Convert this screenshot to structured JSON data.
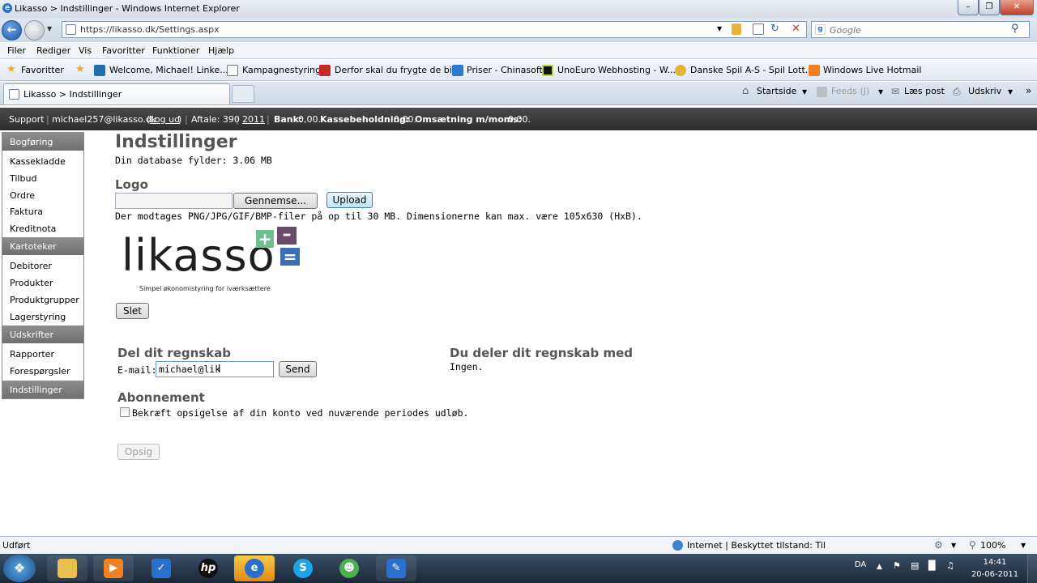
{
  "window": {
    "title": "Likasso > Indstillinger - Windows Internet Explorer"
  },
  "address": {
    "url": "https://likasso.dk/Settings.aspx",
    "search_placeholder": "Google"
  },
  "menu": [
    "Filer",
    "Rediger",
    "Vis",
    "Favoritter",
    "Funktioner",
    "Hjælp"
  ],
  "favorites_bar": {
    "favorites_label": "Favoritter",
    "items": [
      "Welcome, Michael! Linke...",
      "Kampagnestyring",
      "Derfor skal du frygte de bi...",
      "Priser - Chinasoft",
      "UnoEuro Webhosting - W...",
      "Danske Spil A-S - Spil Lott...",
      "Windows Live Hotmail"
    ]
  },
  "tab": {
    "label": "Likasso > Indstillinger"
  },
  "commandbar": {
    "home": "Startside",
    "feeds": "Feeds (J)",
    "read_mail": "Læs post",
    "print": "Udskriv"
  },
  "topbar": {
    "support": "Support",
    "email": "michael257@likasso.dk",
    "logout": "Log ud",
    "agreement": "Aftale: 390",
    "year": "2011",
    "bank_label": "Bank:",
    "bank_value": "0,00.",
    "cash_label": "Kassebeholdning:",
    "cash_value": "0,00.",
    "turnover_label": "Omsætning m/moms:",
    "turnover_value": "0,00."
  },
  "sidebar": {
    "sections": [
      {
        "title": "Bogføring",
        "items": [
          "Kassekladde",
          "Tilbud",
          "Ordre",
          "Faktura",
          "Kreditnota"
        ]
      },
      {
        "title": "Kartoteker",
        "items": [
          "Debitorer",
          "Produkter",
          "Produktgrupper",
          "Lagerstyring"
        ]
      },
      {
        "title": "Udskrifter",
        "items": [
          "Rapporter",
          "Forespørgsler"
        ]
      },
      {
        "title": "Indstillinger",
        "items": []
      }
    ]
  },
  "main": {
    "title": "Indstillinger",
    "db_size": "Din database fylder: 3.06 MB",
    "logo_heading": "Logo",
    "browse_button": "Gennemse...",
    "upload_button": "Upload",
    "logo_hint": "Der modtages PNG/JPG/GIF/BMP-filer på op til 30 MB. Dimensionerne kan max. være 105x630 (HxB).",
    "logo_text": "likasso",
    "logo_tagline": "Simpel økonomistyring for iværksættere",
    "delete_button": "Slet",
    "share_heading": "Del dit regnskab",
    "email_label": "E-mail:",
    "email_value": "michael@lik",
    "send_button": "Send",
    "shared_with_heading": "Du deler dit regnskab med",
    "shared_with_value": "Ingen.",
    "subscription_heading": "Abonnement",
    "confirm_checkbox_label": "Bekræft opsigelse af din konto ved nuværende periodes udløb.",
    "cancel_button": "Opsig"
  },
  "statusbar": {
    "left": "Udført",
    "zone": "Internet | Beskyttet tilstand: Til",
    "zoom": "100%"
  },
  "taskbar": {
    "lang": "DA",
    "time": "14:41",
    "date": "20-06-2011"
  },
  "colors": {
    "ie_blue": "#2a6fc9",
    "topbar_bg": "#333333",
    "sidebar_head": "#7d7d7d",
    "logo_green": "#6fbf8f",
    "logo_purple": "#6b4a6d",
    "logo_blue": "#3b6fb6"
  }
}
